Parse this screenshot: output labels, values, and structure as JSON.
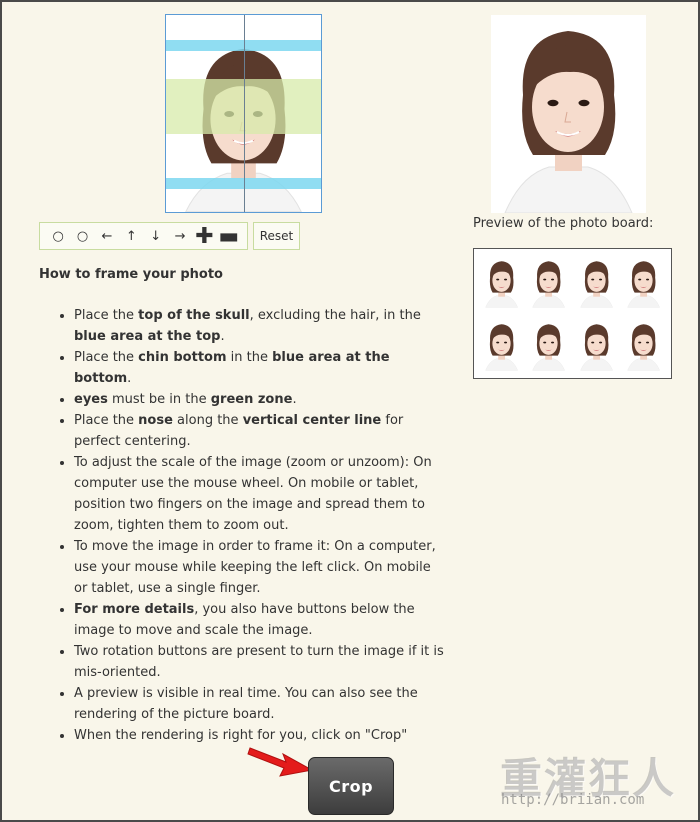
{
  "editor": {
    "controls": [
      {
        "name": "rotate-left",
        "glyph": "○"
      },
      {
        "name": "rotate-right",
        "glyph": "○"
      },
      {
        "name": "move-left",
        "glyph": "←"
      },
      {
        "name": "move-up",
        "glyph": "↑"
      },
      {
        "name": "move-down",
        "glyph": "↓"
      },
      {
        "name": "move-right",
        "glyph": "→"
      },
      {
        "name": "zoom-in",
        "glyph": "✚"
      },
      {
        "name": "zoom-out",
        "glyph": "▬"
      }
    ],
    "reset_label": "Reset",
    "guide_colors": {
      "blue": "#7dd7f0",
      "green": "#d7ebaa",
      "line": "#6a7f92"
    }
  },
  "preview": {
    "label": "Preview of the photo board:"
  },
  "instructions": {
    "heading": "How to frame your photo",
    "items": [
      [
        {
          "t": "Place the "
        },
        {
          "t": "top of the skull",
          "b": true
        },
        {
          "t": ", excluding the hair, in the "
        },
        {
          "t": "blue area at the top",
          "b": true
        },
        {
          "t": "."
        }
      ],
      [
        {
          "t": "Place the "
        },
        {
          "t": "chin bottom",
          "b": true
        },
        {
          "t": " in the "
        },
        {
          "t": "blue area at the bottom",
          "b": true
        },
        {
          "t": "."
        }
      ],
      [
        {
          "t": "eyes",
          "b": true
        },
        {
          "t": " must be in the "
        },
        {
          "t": "green zone",
          "b": true
        },
        {
          "t": "."
        }
      ],
      [
        {
          "t": "Place the "
        },
        {
          "t": "nose",
          "b": true
        },
        {
          "t": " along the "
        },
        {
          "t": "vertical center line",
          "b": true
        },
        {
          "t": " for perfect centering."
        }
      ],
      [
        {
          "t": "To adjust the scale of the image (zoom or unzoom): On computer use the mouse wheel. On mobile or tablet, position two fingers on the image and spread them to zoom, tighten them to zoom out."
        }
      ],
      [
        {
          "t": "To move the image in order to frame it: On a computer, use your mouse while keeping the left click. On mobile or tablet, use a single finger."
        }
      ],
      [
        {
          "t": "For more details",
          "b": true
        },
        {
          "t": ", you also have buttons below the image to move and scale the image."
        }
      ],
      [
        {
          "t": "Two rotation buttons are present to turn the image if it is mis-oriented."
        }
      ],
      [
        {
          "t": "A preview is visible in real time. You can also see the rendering of the picture board."
        }
      ],
      [
        {
          "t": "When the rendering is right for you, click on \"Crop\""
        }
      ]
    ]
  },
  "crop": {
    "label": "Crop"
  },
  "watermark": {
    "title": "重灌狂人",
    "url": "http://briian.com"
  }
}
